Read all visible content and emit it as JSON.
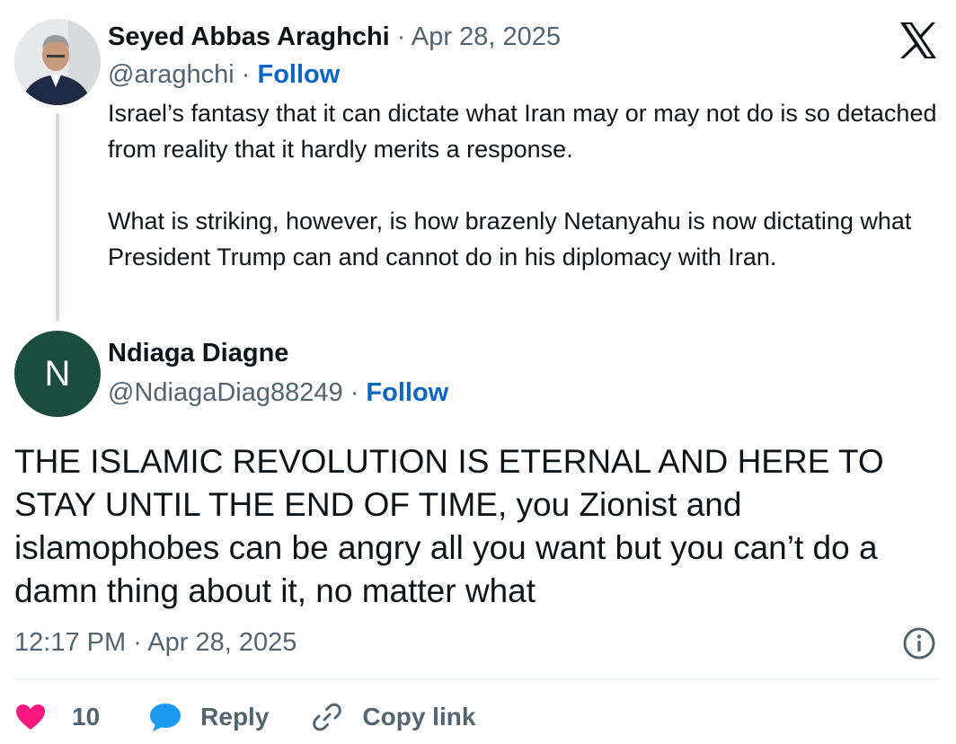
{
  "original": {
    "author_name": "Seyed Abbas Araghchi",
    "separator": "·",
    "date": "Apr 28, 2025",
    "handle": "@araghchi",
    "follow_label": "Follow",
    "paragraphs": [
      "Israel’s fantasy that it can dictate what Iran may or may not do is so detached from reality that it hardly merits a response.",
      "What is striking, however, is how brazenly Netanyahu is now dictating what President Trump can and cannot do in his diplomacy with Iran."
    ]
  },
  "reply": {
    "author_name": "Ndiaga Diagne",
    "avatar_initial": "N",
    "avatar_color": "#1b4d3e",
    "handle": "@NdiagaDiag88249",
    "separator": "·",
    "follow_label": "Follow",
    "text": "THE ISLAMIC REVOLUTION IS ETERNAL AND HERE TO STAY UNTIL THE END OF TIME, you Zionist and islamophobes can be angry all you want but you can’t do a damn thing about it, no matter what",
    "timestamp": "12:17 PM · Apr 28, 2025"
  },
  "actions": {
    "like_count": "10",
    "reply_label": "Reply",
    "copy_link_label": "Copy link"
  },
  "icons": {
    "brand": "x-logo-icon",
    "like": "heart-icon",
    "reply": "speech-bubble-icon",
    "copy": "link-icon",
    "info": "info-icon"
  },
  "colors": {
    "heart": "#f91880",
    "reply_bubble": "#1d9bf0",
    "follow": "#0a66c2",
    "muted": "#536471"
  }
}
